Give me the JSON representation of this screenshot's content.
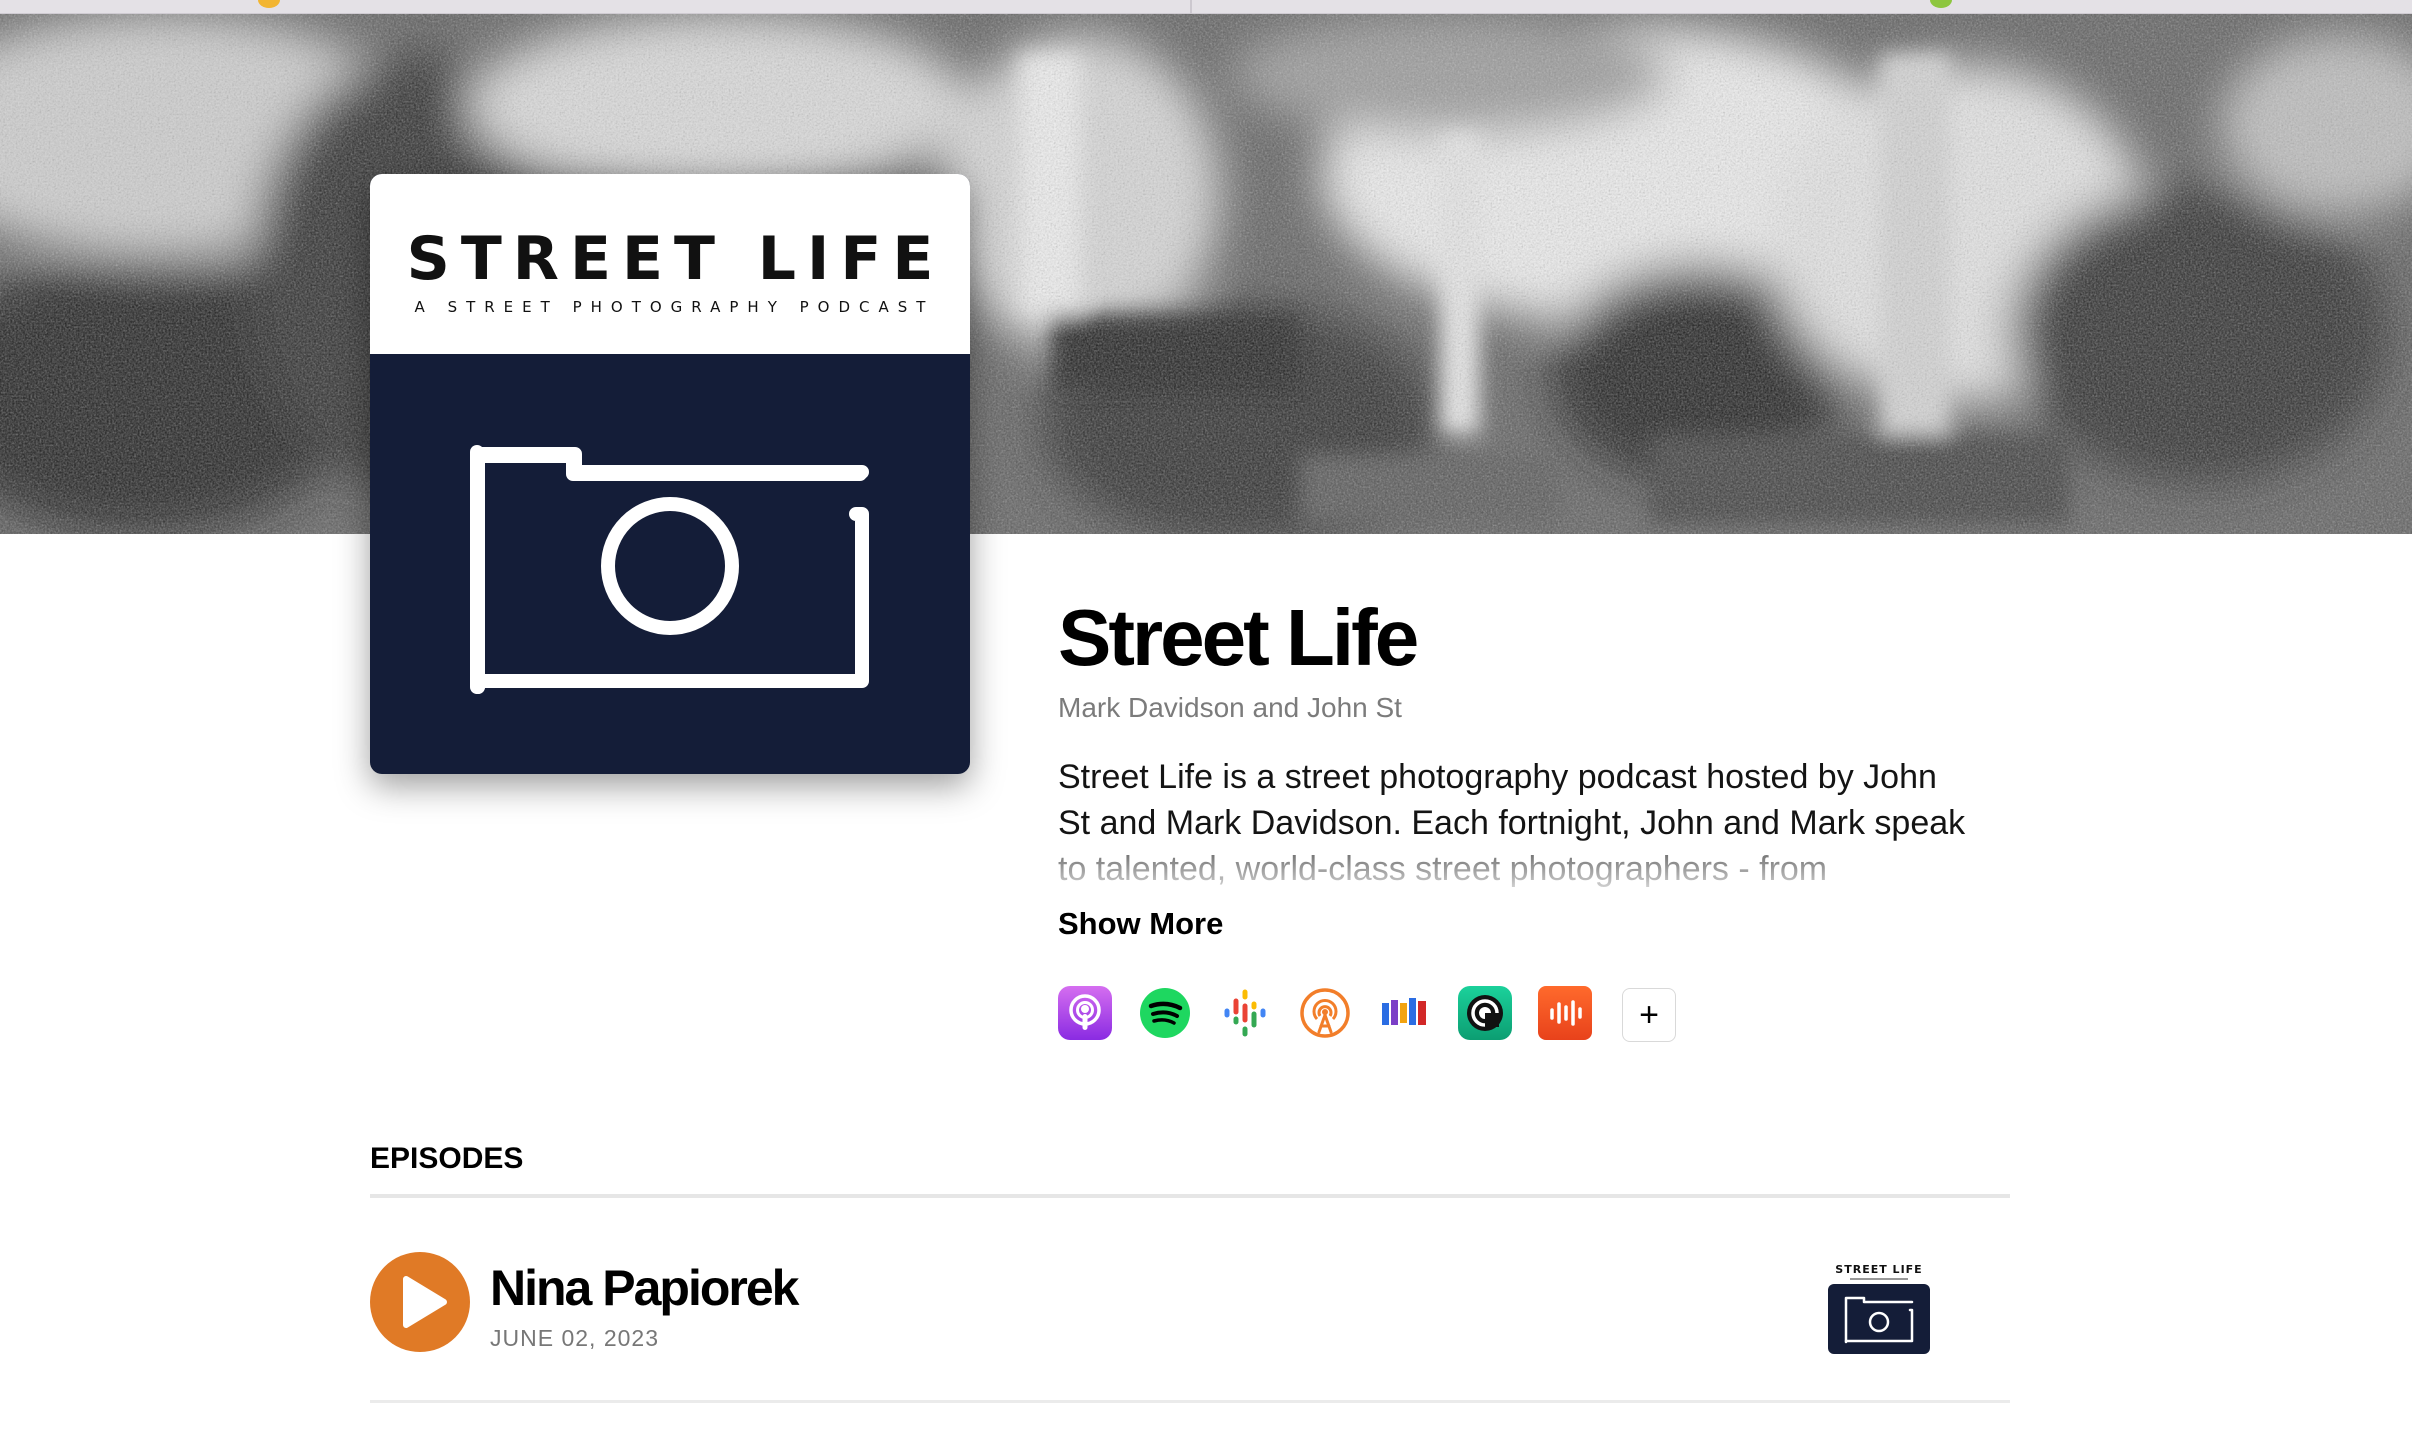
{
  "podcast": {
    "title": "Street Life",
    "authors": "Mark Davidson and John St",
    "description": "Street Life is a street photography podcast hosted by John St and Mark Davidson. Each fortnight, John and Mark speak to talented, world-class street photographers - from traditional",
    "show_more_label": "Show More"
  },
  "cover": {
    "title": "STREET LIFE",
    "subtitle": "A STREET PHOTOGRAPHY PODCAST",
    "background_color": "#141d38"
  },
  "platforms": [
    {
      "icon": "apple-podcasts-icon",
      "color": "#b43ed4"
    },
    {
      "icon": "spotify-icon",
      "color": "#1ed760"
    },
    {
      "icon": "google-podcasts-icon",
      "color": "#4285f4"
    },
    {
      "icon": "overcast-icon",
      "color": "#f27e2a"
    },
    {
      "icon": "podcast-index-icon",
      "color": "#d22828"
    },
    {
      "icon": "pocket-casts-icon",
      "color": "#16c38d"
    },
    {
      "icon": "castbox-icon",
      "color": "#f55b23"
    }
  ],
  "more_platforms_label": "+",
  "episodes": {
    "heading": "EPISODES",
    "items": [
      {
        "title": "Nina Papiorek",
        "date": "JUNE 02, 2023",
        "thumb_title": "STREET LIFE",
        "play_color": "#e07a26"
      }
    ]
  }
}
